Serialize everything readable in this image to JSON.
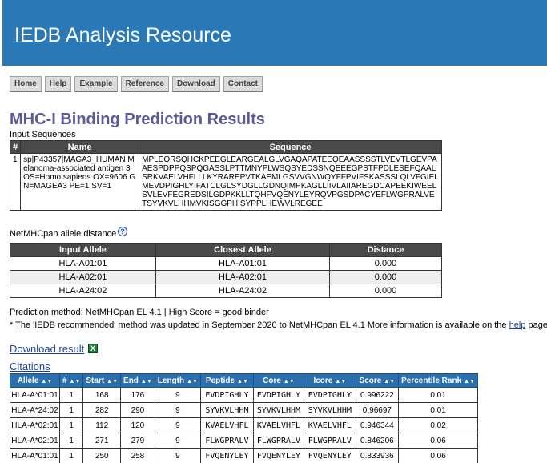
{
  "header": {
    "title": "IEDB Analysis Resource"
  },
  "nav": [
    "Home",
    "Help",
    "Example",
    "Reference",
    "Download",
    "Contact"
  ],
  "page_title": "MHC-I Binding Prediction Results",
  "input_sequences": {
    "label": "Input Sequences",
    "headers": [
      "#",
      "Name",
      "Sequence"
    ],
    "rows": [
      {
        "num": "1",
        "name": "sp|P43357|MAGA3_HUMAN Melanoma-associated antigen 3 OS=Homo sapiens OX=9606 GN=MAGEA3 PE=1 SV=1",
        "sequence": "MPLEQRSQHCKPEEGLEARGEALGLVGAQAPATEEQEAASSSSTLVEVTLGEVPAAESPDPPQSPQGASSLPTTMNYPLWSQSYEDSSNQEEEGPSTFPDLESEFQAALSRKVAELVHFLLLKYRAREPVTKAEMLGSVVGNWQYFFPVIFSKASSSLQLVFGIELMEVDPIGHLYIFATCLGLSYDGLLGDNQIMPKAGLLIIVLAIIAREGDCAPEEKIWEELSVLEVFEGREDSILGDPKKLLTQHFVQENYLEYRQVPGSDPACYEFLWGPRALVETSYVKVLHHMVKISGGPHISYPPLHEWVLREGEE"
      }
    ]
  },
  "allele_distance": {
    "label": "NetMHCpan allele distance",
    "help_glyph": "?",
    "headers": [
      "Input Allele",
      "Closest Allele",
      "Distance"
    ],
    "rows": [
      [
        "HLA-A01:01",
        "HLA-A01:01",
        "0.000"
      ],
      [
        "HLA-A02:01",
        "HLA-A02:01",
        "0.000"
      ],
      [
        "HLA-A24:02",
        "HLA-A24:02",
        "0.000"
      ]
    ]
  },
  "prediction_method": "Prediction method: NetMHCpan EL 4.1 | High Score = good binder",
  "note": {
    "before": "* The 'IEDB recommended' method was updated in September 2020 to NetMHCpan EL 4.1 More information is available on the ",
    "link": "help",
    "after": " page."
  },
  "download": {
    "label": "Download result",
    "icon": "excel-icon",
    "glyph": "X"
  },
  "citations": "Citations",
  "results": {
    "headers": [
      "Allele",
      "#",
      "Start",
      "End",
      "Length",
      "Peptide",
      "Core",
      "Icore",
      "Score",
      "Percentile Rank"
    ],
    "rows": [
      [
        "HLA-A*01:01",
        "1",
        "168",
        "176",
        "9",
        "EVDPIGHLY",
        "EVDPIGHLY",
        "EVDPIGHLY",
        "0.996222",
        "0.01"
      ],
      [
        "HLA-A*24:02",
        "1",
        "282",
        "290",
        "9",
        "SYVKVLHHM",
        "SYVKVLHHM",
        "SYVKVLHHM",
        "0.96697",
        "0.01"
      ],
      [
        "HLA-A*02:01",
        "1",
        "112",
        "120",
        "9",
        "KVAELVHFL",
        "KVAELVHFL",
        "KVAELVHFL",
        "0.946344",
        "0.02"
      ],
      [
        "HLA-A*02:01",
        "1",
        "271",
        "279",
        "9",
        "FLWGPRALV",
        "FLWGPRALV",
        "FLWGPRALV",
        "0.846206",
        "0.06"
      ],
      [
        "HLA-A*01:01",
        "1",
        "250",
        "258",
        "9",
        "FVQENYLEY",
        "FVQENYLEY",
        "FVQENYLEY",
        "0.833936",
        "0.06"
      ]
    ]
  },
  "colors": {
    "header_bg": "#2b78b6",
    "title": "#5a5a9a",
    "table_header": "#4a4a4a",
    "results_header": "#2b6fae",
    "link": "#1e3f99"
  }
}
